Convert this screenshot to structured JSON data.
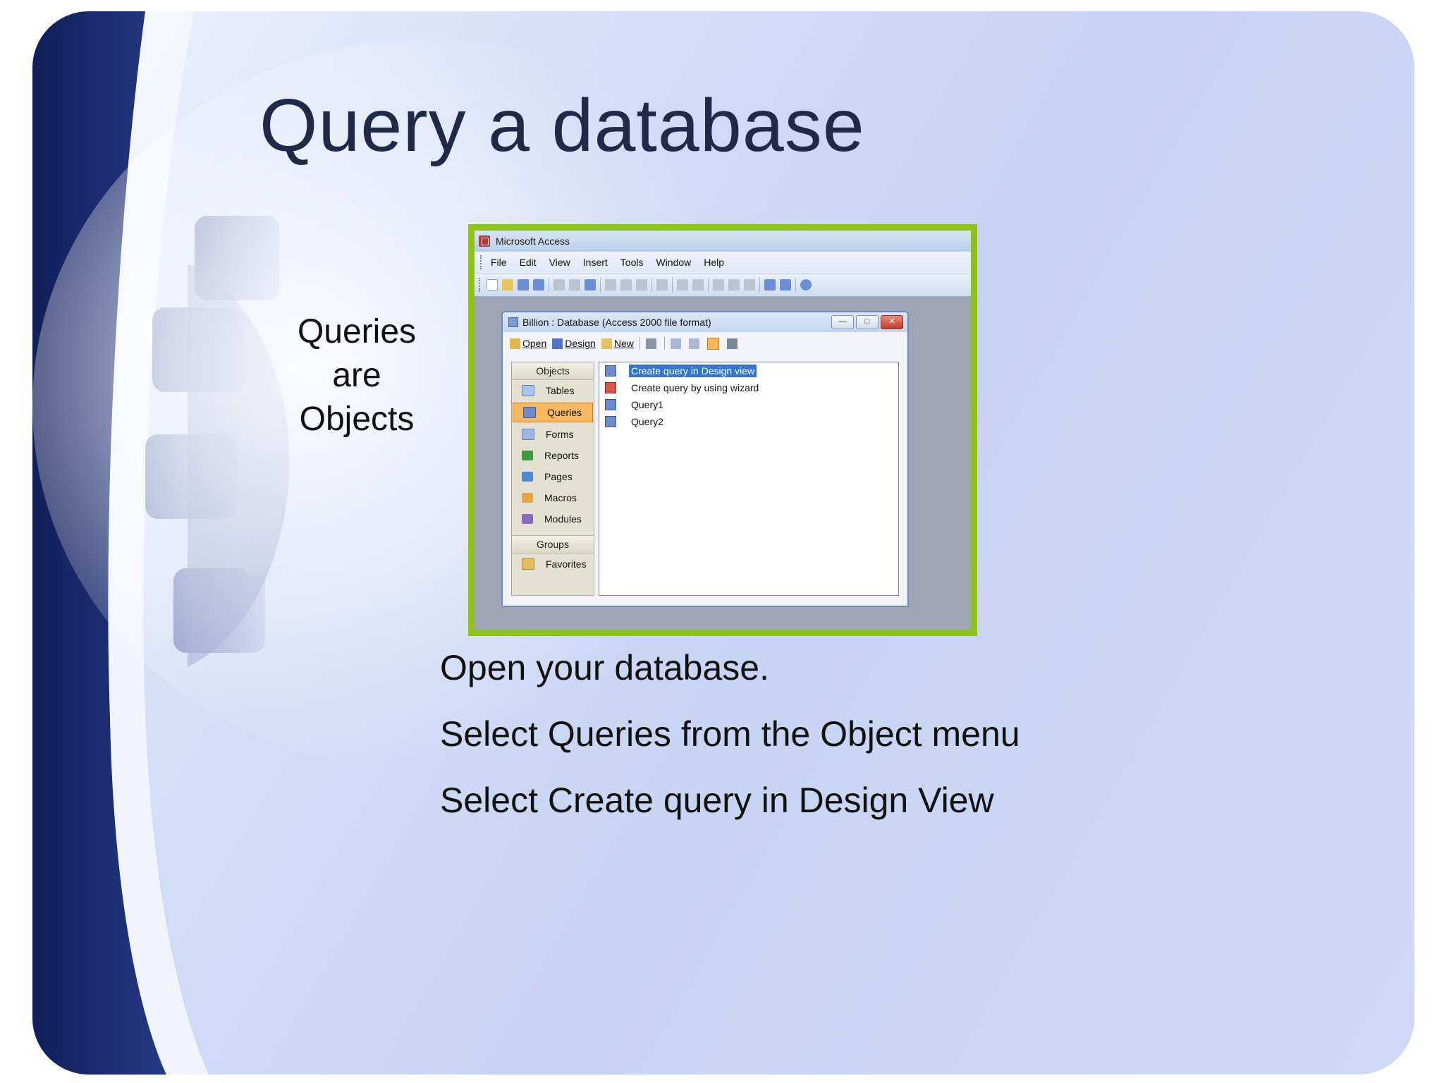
{
  "slide": {
    "title": "Query a database",
    "side_note": [
      "Queries",
      "are",
      "Objects"
    ],
    "bullets": [
      "Open your database.",
      "Select Queries from the Object menu",
      "Select Create query in Design View"
    ]
  },
  "access_window": {
    "app_title": "Microsoft Access",
    "menu": [
      "File",
      "Edit",
      "View",
      "Insert",
      "Tools",
      "Window",
      "Help"
    ],
    "db_window": {
      "title": "Billion : Database (Access 2000 file format)",
      "toolbar": {
        "open": "Open",
        "design": "Design",
        "new": "New"
      },
      "objects_header": "Objects",
      "objects": [
        "Tables",
        "Queries",
        "Forms",
        "Reports",
        "Pages",
        "Macros",
        "Modules"
      ],
      "selected_object": "Queries",
      "groups_header": "Groups",
      "groups": [
        "Favorites"
      ],
      "items": [
        "Create query in Design view",
        "Create query by using wizard",
        "Query1",
        "Query2"
      ],
      "selected_item": "Create query in Design view"
    }
  },
  "colors": {
    "title": "#202a48",
    "frame_border": "#8fc11b",
    "selection": "#3375d7",
    "object_highlight": "#f8b861"
  }
}
